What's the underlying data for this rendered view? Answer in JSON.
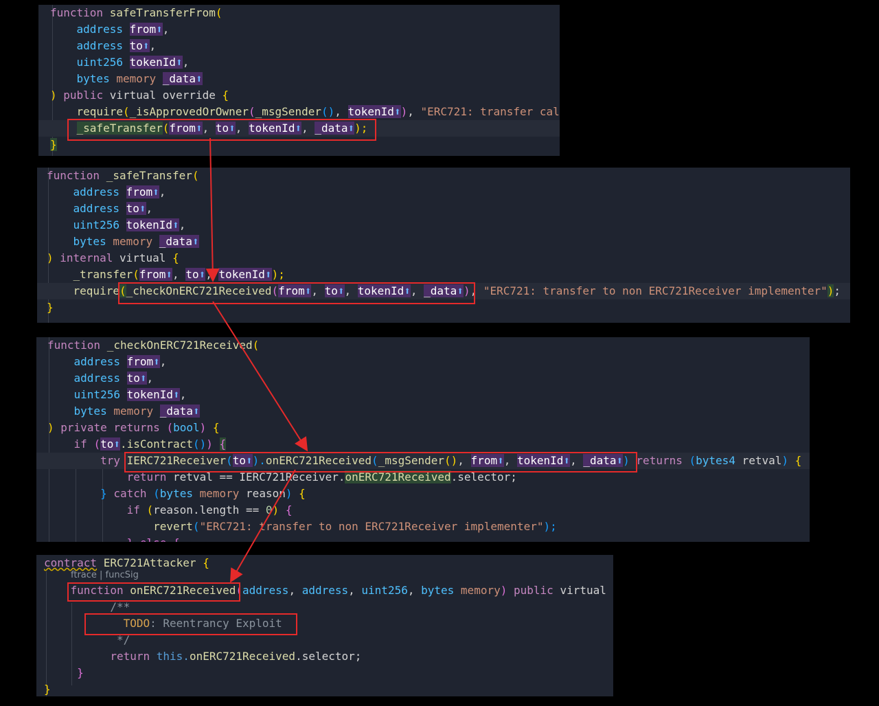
{
  "p1": {
    "l1": [
      "function",
      "safeTransferFrom",
      "("
    ],
    "l2": [
      "address",
      "from",
      "⬆",
      ","
    ],
    "l3": [
      "address",
      "to",
      "⬆",
      ","
    ],
    "l4": [
      "uint256",
      "tokenId",
      "⬆",
      ","
    ],
    "l5": [
      "bytes",
      "memory",
      "_data",
      "⬆"
    ],
    "l6": [
      ")",
      "public",
      "virtual",
      "override",
      "{"
    ],
    "l7": [
      "require",
      "(",
      "_isApprovedOrOwner",
      "(",
      "_msgSender",
      "()",
      ", ",
      "tokenId",
      "⬆",
      ")",
      ", ",
      "\"ERC721: transfer cal"
    ],
    "l8": [
      "_safeTransfer",
      "(",
      "from",
      "⬆",
      ", ",
      "to",
      "⬆",
      ", ",
      "tokenId",
      "⬆",
      ", ",
      "_data",
      "⬆",
      ");"
    ],
    "l9": "}"
  },
  "p2": {
    "l1": [
      "function",
      "_safeTransfer",
      "("
    ],
    "l2": [
      "address",
      "from",
      "⬆",
      ","
    ],
    "l3": [
      "address",
      "to",
      "⬆",
      ","
    ],
    "l4": [
      "uint256",
      "tokenId",
      "⬆",
      ","
    ],
    "l5": [
      "bytes",
      "memory",
      "_data",
      "⬆"
    ],
    "l6": [
      ")",
      "internal",
      "virtual",
      "{"
    ],
    "l7": [
      "_transfer",
      "(",
      "from",
      "⬆",
      ", ",
      "to",
      "⬆",
      ", ",
      "tokenId",
      "⬆",
      ");"
    ],
    "l8": [
      "require",
      "(",
      "_checkOnERC721Received",
      "(",
      "from",
      "⬆",
      ", ",
      "to",
      "⬆",
      ", ",
      "tokenId",
      "⬆",
      ", ",
      "_data",
      "⬆",
      ")",
      ", ",
      "\"ERC721: transfer to non ERC721Receiver implementer\"",
      ")",
      ";"
    ],
    "l9": "}"
  },
  "p3": {
    "l1": [
      "function",
      "_checkOnERC721Received",
      "("
    ],
    "l2": [
      "address",
      "from",
      "⬆",
      ","
    ],
    "l3": [
      "address",
      "to",
      "⬆",
      ","
    ],
    "l4": [
      "uint256",
      "tokenId",
      "⬆",
      ","
    ],
    "l5": [
      "bytes",
      "memory",
      "_data",
      "⬆"
    ],
    "l6": [
      ")",
      "private",
      "returns",
      "(",
      "bool",
      ")",
      "{"
    ],
    "l7": [
      "if",
      "(",
      "to",
      "⬆",
      ".isContract",
      "()",
      ")",
      "{"
    ],
    "l8": [
      "try",
      "IERC721Receiver",
      "(",
      "to",
      "⬆",
      ").",
      "onERC721Received",
      "(",
      "_msgSender",
      "()",
      ", ",
      "from",
      "⬆",
      ", ",
      "tokenId",
      "⬆",
      ", ",
      "_data",
      "⬆",
      ")",
      "returns",
      "(",
      "bytes4",
      "retval",
      ")",
      "{"
    ],
    "l9": [
      "return",
      "retval == IERC721Receiver.",
      "onERC721Received",
      ".selector;"
    ],
    "l10": [
      "}",
      "catch",
      "(",
      "bytes",
      "memory",
      "reason",
      ")",
      "{"
    ],
    "l11": [
      "if",
      "(",
      "reason.length == ",
      "0",
      ")",
      "{"
    ],
    "l12": [
      "revert",
      "(",
      "\"ERC721: transfer to non ERC721Receiver implementer\"",
      ");"
    ],
    "l13": "} else {"
  },
  "p4": {
    "l1": [
      "contract",
      "ERC721Attacker",
      "{"
    ],
    "lens": "ftrace | funcSig",
    "l2": [
      "function",
      "onERC721Received",
      "(",
      "address",
      ", ",
      "address",
      ", ",
      "uint256",
      ", ",
      "bytes",
      "memory",
      ")",
      "public",
      "virtual"
    ],
    "l3": "/**",
    "l4": [
      "TODO",
      ": Reentrancy Exploit"
    ],
    "l5": "*/",
    "l6": [
      "return",
      "this.",
      "onERC721Received",
      ".selector;"
    ],
    "l7": "}",
    "l8": "}"
  }
}
